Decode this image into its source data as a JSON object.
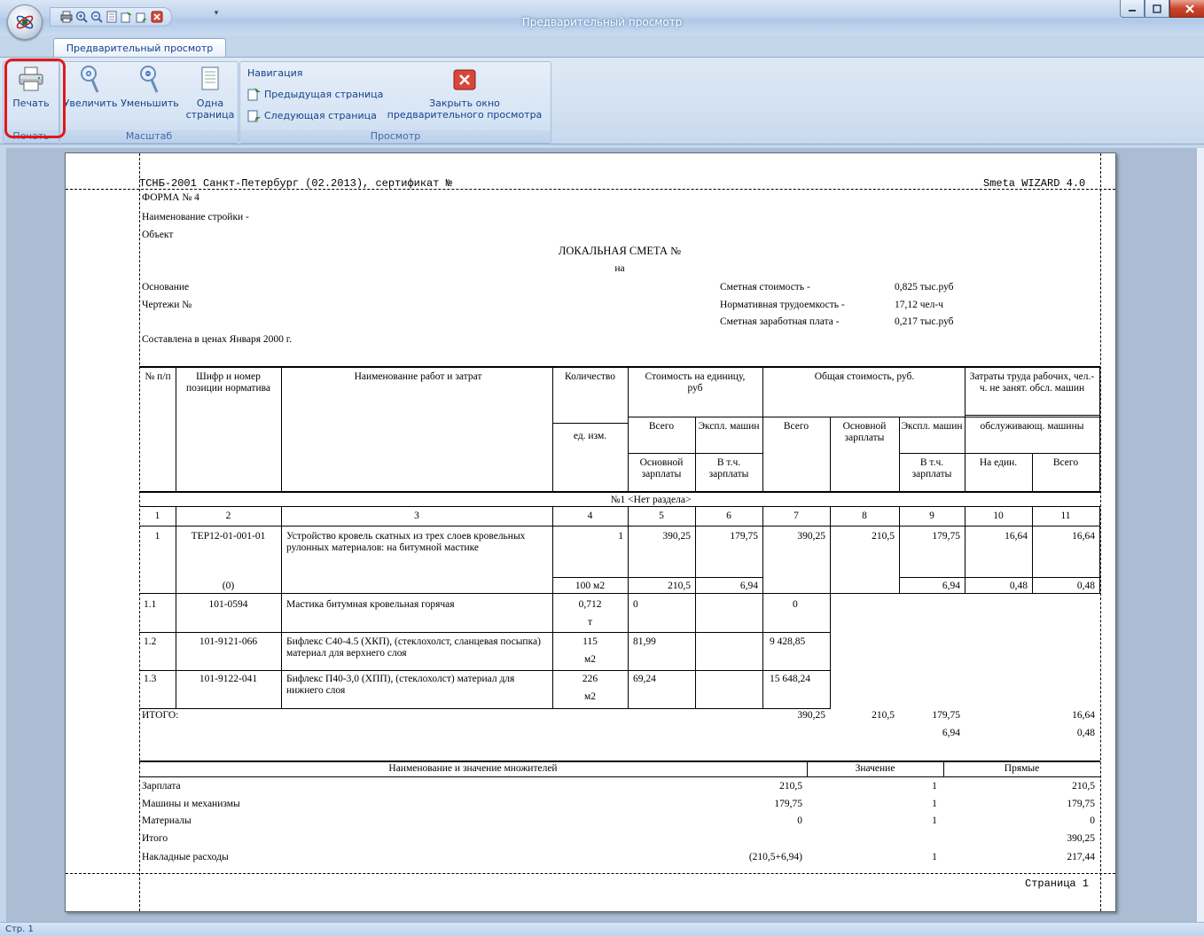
{
  "window": {
    "title": "Предварительный просмотр"
  },
  "ribbon": {
    "tab": "Предварительный просмотр",
    "groups": {
      "print": "Печать",
      "scale": "Масштаб",
      "view": "Просмотр"
    },
    "buttons": {
      "print": "Печать",
      "zoom_in": "Увеличить",
      "zoom_out": "Уменьшить",
      "one_page_1": "Одна",
      "one_page_2": "страница",
      "close_1": "Закрыть окно",
      "close_2": "предварительного просмотра"
    },
    "navigation": {
      "title": "Навигация",
      "prev": "Предыдущая страница",
      "next": "Следующая страница"
    }
  },
  "status": {
    "page": "Стр. 1"
  },
  "document": {
    "header_left": "ТСНБ-2001 Санкт-Петербург (02.2013), сертификат №",
    "header_right": "Smeta WIZARD 4.0",
    "form": "ФОРМА № 4",
    "construction": "Наименование стройки -",
    "object": "Объект",
    "title": "ЛОКАЛЬНАЯ СМЕТА №",
    "title_on": "на",
    "basis": "Основание",
    "drawings": "Чертежи №",
    "prices": "Составлена в ценах Января 2000 г.",
    "summary": [
      {
        "label": "Сметная стоимость -",
        "value": "0,825 тыс.руб"
      },
      {
        "label": "Нормативная трудоемкость -",
        "value": "17,12 чел-ч"
      },
      {
        "label": "Сметная заработная плата -",
        "value": "0,217 тыс.руб"
      }
    ],
    "table_headers": {
      "num": "№ п/п",
      "code": "Шифр и номер позиции норматива",
      "name": "Наименование работ и затрат",
      "qty": "Количество",
      "unit": "ед. изм.",
      "unit_cost": "Стоимость на единицу, руб",
      "total_cost": "Общая стоимость, руб.",
      "labor": "Затраты труда рабочих, чел.-ч. не занят. обсл. машин",
      "total": "Всего",
      "machines": "Экспл. машин",
      "base_salary": "Основной зарплаты",
      "incl_salary": "В т.ч. зарплаты",
      "operators": "обслуживающ. машины",
      "per_unit": "На един.",
      "all": "Всего"
    },
    "section": "№1 <Нет раздела>",
    "col_numbers": [
      "1",
      "2",
      "3",
      "4",
      "5",
      "6",
      "7",
      "8",
      "9",
      "10",
      "11"
    ],
    "rows": [
      {
        "n": "1",
        "code": "ТЕР12-01-001-01",
        "code2": "(0)",
        "name": "Устройство кровель скатных из трех слоев кровельных рулонных материалов: на битумной мастике",
        "qty": "1",
        "unit": "100 м2",
        "c5": "390,25",
        "c5b": "210,5",
        "c6": "179,75",
        "c6b": "6,94",
        "c7": "390,25",
        "c8": "210,5",
        "c9": "179,75",
        "c9b": "6,94",
        "c10": "16,64",
        "c10b": "0,48",
        "c11": "16,64",
        "c11b": "0,48"
      },
      {
        "n": "1.1",
        "code": "101-0594",
        "name": "Мастика битумная кровельная горячая",
        "qty": "0,712",
        "unit": "т",
        "c5": "0",
        "c7": "0"
      },
      {
        "n": "1.2",
        "code": "101-9121-066",
        "name": "Бифлекс С40-4.5 (ХКП), (стеклохолст, сланцевая посыпка) материал для верхнего слоя",
        "qty": "115",
        "unit": "м2",
        "c5": "81,99",
        "c7": "9 428,85"
      },
      {
        "n": "1.3",
        "code": "101-9122-041",
        "name": "Бифлекс П40-3,0 (ХПП), (стеклохолст) материал для нижнего слоя",
        "qty": "226",
        "unit": "м2",
        "c5": "69,24",
        "c7": "15 648,24"
      }
    ],
    "total": {
      "label": "ИТОГО:",
      "c7": "390,25",
      "c8": "210,5",
      "c9": "179,75",
      "c9b": "6,94",
      "c11": "16,64",
      "c11b": "0,48"
    },
    "mult_headers": {
      "name": "Наименование и значение множителей",
      "value": "Значение",
      "direct": "Прямые"
    },
    "mult_rows": [
      {
        "name": "Зарплата",
        "v": "210,5",
        "k": "1",
        "d": "210,5"
      },
      {
        "name": "Машины и механизмы",
        "v": "179,75",
        "k": "1",
        "d": "179,75"
      },
      {
        "name": "Материалы",
        "v": "0",
        "k": "1",
        "d": "0"
      },
      {
        "name": "Итого",
        "v": "",
        "k": "",
        "d": "390,25"
      },
      {
        "name": "Накладные расходы",
        "v": "(210,5+6,94)",
        "k": "1",
        "d": "217,44"
      }
    ],
    "footer": "Страница 1"
  }
}
